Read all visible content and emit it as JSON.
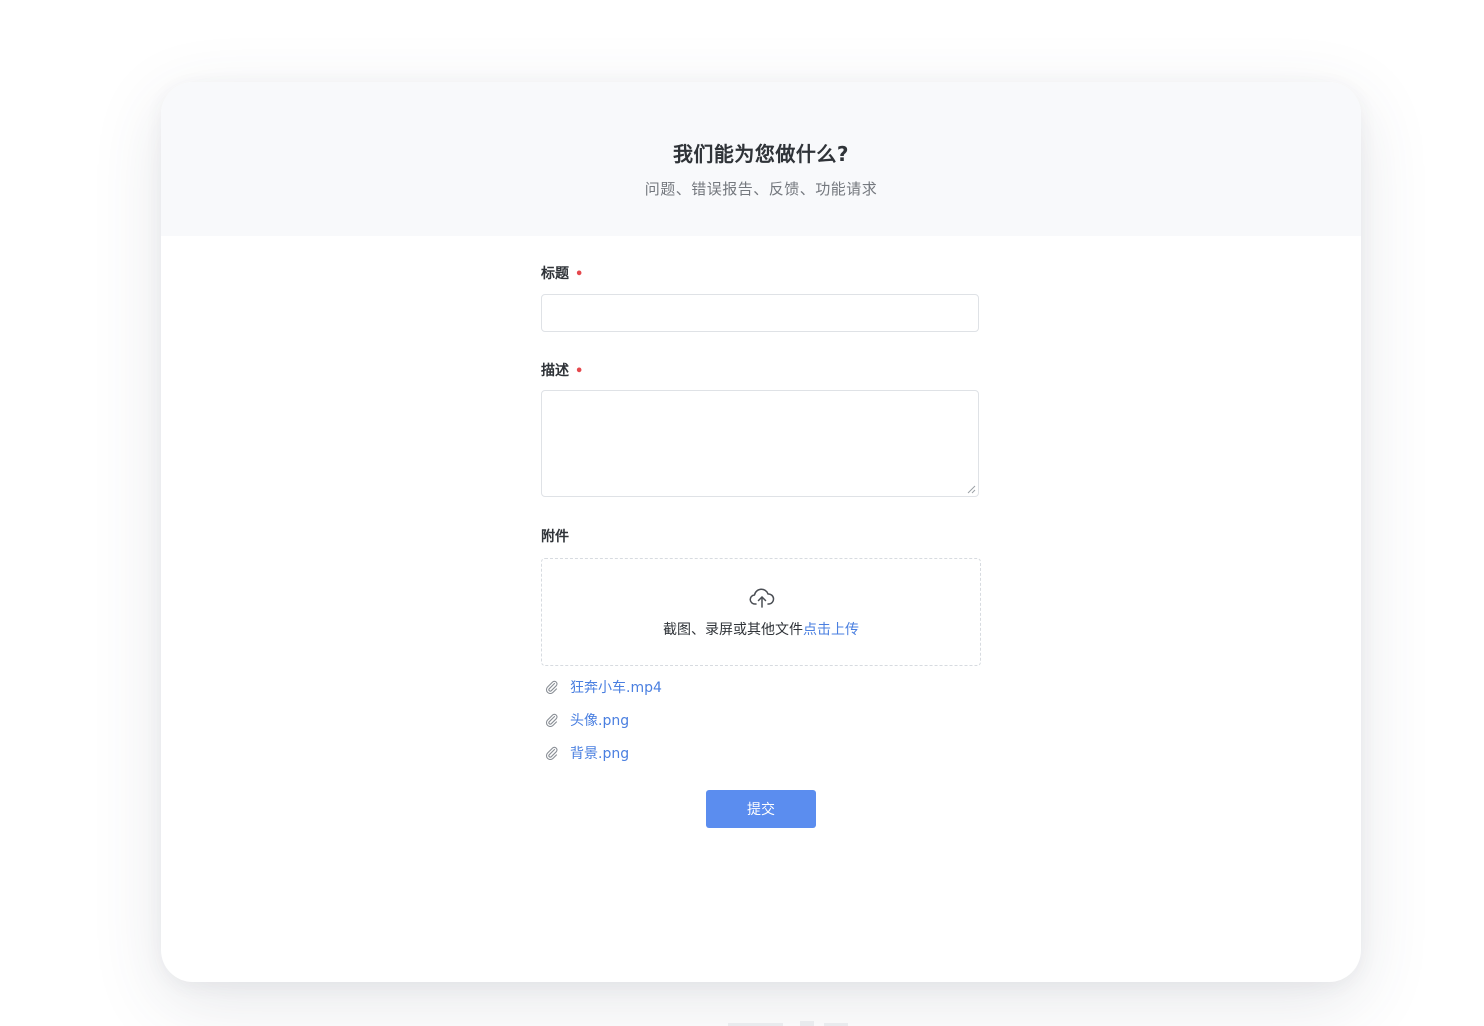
{
  "header": {
    "title": "我们能为您做什么?",
    "subtitle": "问题、错误报告、反馈、功能请求"
  },
  "form": {
    "title_field": {
      "label": "标题",
      "required_mark": "•",
      "value": ""
    },
    "description_field": {
      "label": "描述",
      "required_mark": "•",
      "value": ""
    },
    "attachment_field": {
      "label": "附件"
    },
    "upload": {
      "icon": "cloud-upload-icon",
      "text": "截图、录屏或其他文件",
      "link": "点击上传"
    },
    "files": [
      {
        "name": "狂奔小车.mp4",
        "icon": "paperclip-icon"
      },
      {
        "name": "头像.png",
        "icon": "paperclip-icon"
      },
      {
        "name": "背景.png",
        "icon": "paperclip-icon"
      }
    ],
    "submit_label": "提交"
  },
  "colors": {
    "primary": "#5b8def",
    "link": "#4a7fe0",
    "required": "#e5484d",
    "header_bg": "#f8f9fb"
  }
}
